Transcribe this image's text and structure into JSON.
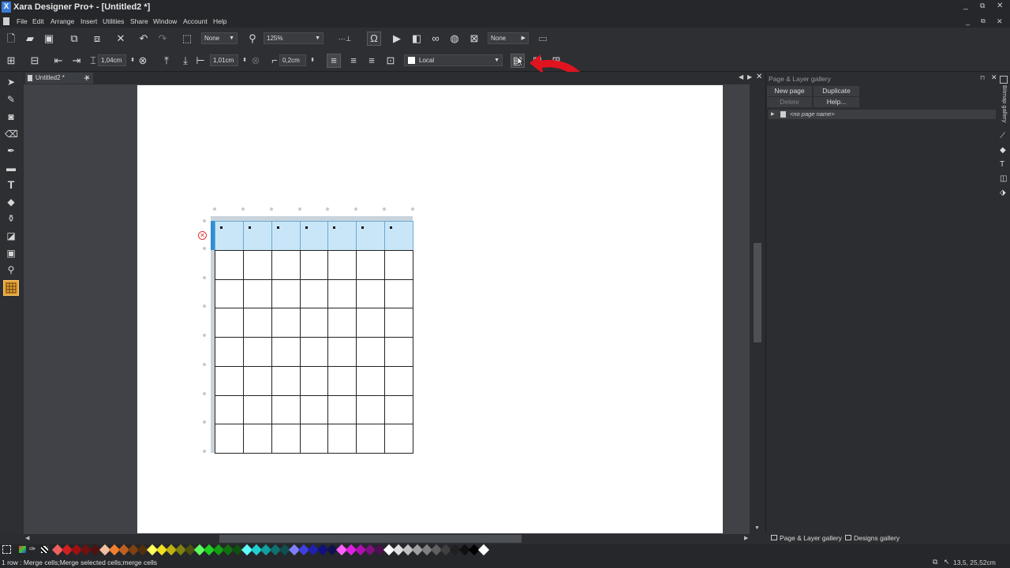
{
  "app": {
    "title": "Xara Designer Pro+ - [Untitled2 *]",
    "logo": "X",
    "window_controls": [
      "_",
      "⧉",
      "✕"
    ],
    "doc_controls": [
      "_",
      "⧉",
      "✕"
    ]
  },
  "menu": [
    "File",
    "Edit",
    "Arrange",
    "Insert",
    "Utilities",
    "Share",
    "Window",
    "Account",
    "Help"
  ],
  "toolbar1": {
    "quality_combo": "None",
    "zoom_combo": "125%",
    "feather_combo": "None"
  },
  "toolbar2": {
    "row_height": "1,04cm",
    "col_width": "1,01cm",
    "cell_margin": "0,2cm",
    "style_combo": "Local"
  },
  "document": {
    "tab_label": "Untitled2 *",
    "add_tab": "+"
  },
  "gallery": {
    "title": "Page & Layer gallery",
    "buttons": [
      "New page",
      "Duplicate",
      "Delete",
      "Help..."
    ],
    "page_row": "<no page name>",
    "side_label": "Bitmap gallery",
    "bottom_tabs": [
      "Page & Layer gallery",
      "Designs gallery"
    ]
  },
  "status": {
    "text": "1 row : Merge cells;Merge selected cells;merge cells",
    "coords": "13,5, 25,52cm"
  },
  "table": {
    "rows": 8,
    "cols": 7,
    "selected_row": 1
  },
  "colors": {
    "selection_fill": "#c9e6f8",
    "accent_tool": "#e8a33a",
    "annotation_arrow": "#e0141e"
  }
}
